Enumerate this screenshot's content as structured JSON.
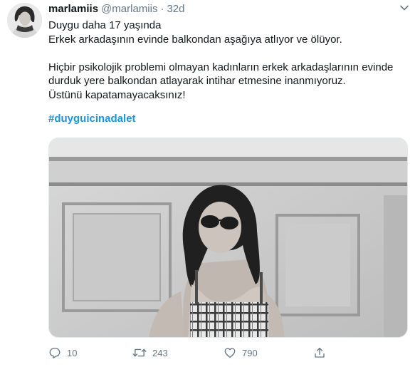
{
  "tweet": {
    "display_name": "marlamiis",
    "handle": "@marlamiis",
    "separator": "·",
    "time": "32d",
    "lines": [
      "Duygu daha 17 yaşında",
      "Erkek arkadaşının evinde balkondan aşağıya atlıyor ve ölüyor.",
      "",
      "Hiçbir psikolojik problemi olmayan kadınların erkek arkadaşlarının evinde",
      "durduk yere balkondan atlayarak intihar etmesine inanmıyoruz.",
      "Üstünü kapatamayacaksınız!"
    ],
    "hashtag": "#duyguicinadalet",
    "hashtag_color": "#1b95e0",
    "avatar_icon": "avatar-photo",
    "media_description_icon": "photo",
    "actions": {
      "reply": {
        "icon": "reply-icon",
        "count": "10"
      },
      "retweet": {
        "icon": "retweet-icon",
        "count": "243"
      },
      "like": {
        "icon": "heart-icon",
        "count": "790"
      },
      "share": {
        "icon": "share-icon"
      }
    },
    "colors": {
      "text": "#14171a",
      "secondary": "#657786",
      "link": "#1b95e0",
      "border": "#e1e8ed"
    }
  }
}
